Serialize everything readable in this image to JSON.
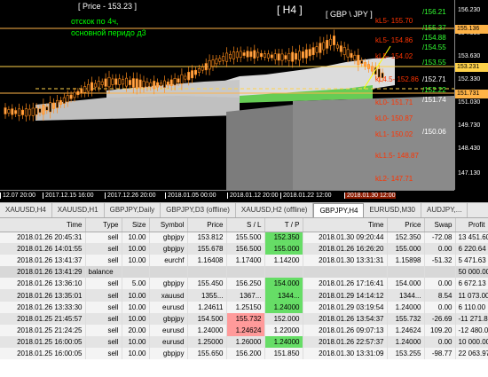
{
  "chart": {
    "title": "[ Price - 153.23 ]",
    "timeframe": "[ H4 ]",
    "pair": "[ GBP \\ JPY ]",
    "note_line1": "отскок по 4ч,",
    "note_line2": "основной перидо д3",
    "y_ticks": [
      "156.230",
      "154.930",
      "153.630",
      "152.330",
      "151.030",
      "149.730",
      "148.430",
      "147.130"
    ],
    "y_markers": [
      {
        "label": "155.136",
        "color": "#ffb347"
      },
      {
        "label": "153.231",
        "color": "#ffd24a"
      },
      {
        "label": "151.731",
        "color": "#ffb347"
      }
    ],
    "x_ticks": [
      "12.07 20:00",
      "2017.12.15 16:00",
      "2017.12.26 20:00",
      "2018.01.05 00:00",
      "2018.01.12 20:00",
      "2018.01.22 12:00",
      "2018.01.30 12:00"
    ],
    "levels_right": [
      {
        "label": "/156.21",
        "color": "#33ff33"
      },
      {
        "label": "/155.37",
        "color": "#33ff33"
      },
      {
        "label": "/154.88",
        "color": "#33ff33"
      },
      {
        "label": "/154.55",
        "color": "#33ff33"
      },
      {
        "label": "/153.55",
        "color": "#33ff33"
      },
      {
        "label": "/152.71",
        "color": "#ffffff"
      },
      {
        "label": "/152.22",
        "color": "#33ff33"
      },
      {
        "label": "/151.74",
        "color": "#ffffff"
      },
      {
        "label": "/150.06",
        "color": "#ffffff"
      }
    ],
    "levels_left": [
      {
        "label": "kL5- 155.70",
        "color": "#ff3300"
      },
      {
        "label": "kL5- 154.86",
        "color": "#ff3300"
      },
      {
        "label": "kL5- 154.02",
        "color": "#ff3300"
      },
      {
        "label": "kL4.5- 152.86",
        "color": "#ff3300"
      },
      {
        "label": "kL0- 151.71",
        "color": "#ff3300"
      },
      {
        "label": "kL0- 150.87",
        "color": "#ff3300"
      },
      {
        "label": "kL1- 150.02",
        "color": "#ff3300"
      },
      {
        "label": "kL1.5- 148.87",
        "color": "#ff3300"
      },
      {
        "label": "kL2- 147.71",
        "color": "#ff3300"
      }
    ]
  },
  "tabs": [
    "XAUUSD,H4",
    "XAUUSD,H1",
    "GBPJPY,Daily",
    "GBPJPY,D3 (offline)",
    "XAUUSD,H2 (offline)",
    "GBPJPY,H4",
    "EURUSD,M30",
    "AUDJPY,..."
  ],
  "active_tab_index": 5,
  "table": {
    "headers": [
      "Time",
      "Type",
      "Size",
      "Symbol",
      "Price",
      "S / L",
      "T / P",
      "Time",
      "Price",
      "Swap",
      "Profit"
    ],
    "rows": [
      [
        "2018.01.26 20:45:31",
        "sell",
        "10.00",
        "gbpjpy",
        "153.812",
        "155.500",
        "152.350",
        "2018.01.30 09:20:44",
        "152.350",
        "-72.08",
        "13 451.60"
      ],
      [
        "2018.01.26 14:01:55",
        "sell",
        "10.00",
        "gbpjpy",
        "155.678",
        "156.500",
        "155.000",
        "2018.01.26 16:26:20",
        "155.000",
        "0.00",
        "6 220.64"
      ],
      [
        "2018.01.26 13:41:37",
        "sell",
        "10.00",
        "eurchf",
        "1.16408",
        "1.17400",
        "1.14200",
        "2018.01.30 13:31:31",
        "1.15898",
        "-51.32",
        "5 471.63"
      ],
      [
        "2018.01.26 13:41:29",
        "balance",
        "",
        "",
        "",
        "",
        "",
        "",
        "",
        "",
        "50 000.00"
      ],
      [
        "2018.01.26 13:36:10",
        "sell",
        "5.00",
        "gbpjpy",
        "155.450",
        "156.250",
        "154.000",
        "2018.01.26 17:16:41",
        "154.000",
        "0.00",
        "6 672.13"
      ],
      [
        "2018.01.26 13:35:01",
        "sell",
        "10.00",
        "xauusd",
        "1355...",
        "1367...",
        "1344...",
        "2018.01.29 14:14:12",
        "1344...",
        "8.54",
        "11 073.00"
      ],
      [
        "2018.01.26 13:33:30",
        "sell",
        "10.00",
        "eurusd",
        "1.24611",
        "1.25150",
        "1.24000",
        "2018.01.29 03:19:54",
        "1.24000",
        "0.00",
        "6 110.00"
      ],
      [
        "2018.01.25 21:45:57",
        "sell",
        "10.00",
        "gbpjpy",
        "154.500",
        "155.732",
        "152.000",
        "2018.01.26 13:54:37",
        "155.732",
        "-26.69",
        "-11 271.83"
      ],
      [
        "2018.01.25 21:24:25",
        "sell",
        "20.00",
        "eurusd",
        "1.24000",
        "1.24624",
        "1.22000",
        "2018.01.26 09:07:13",
        "1.24624",
        "109.20",
        "-12 480.00"
      ],
      [
        "2018.01.25 16:00:05",
        "sell",
        "10.00",
        "eurusd",
        "1.25000",
        "1.26000",
        "1.24000",
        "2018.01.26 22:57:37",
        "1.24000",
        "0.00",
        "10 000.00"
      ],
      [
        "2018.01.25 16:00:05",
        "sell",
        "10.00",
        "gbpjpy",
        "155.650",
        "156.200",
        "151.850",
        "2018.01.30 13:31:09",
        "153.255",
        "-98.77",
        "22 063.97"
      ]
    ],
    "cell_highlights": [
      {
        "row": 0,
        "col": 6,
        "color": "green"
      },
      {
        "row": 1,
        "col": 6,
        "color": "green"
      },
      {
        "row": 4,
        "col": 6,
        "color": "green"
      },
      {
        "row": 5,
        "col": 6,
        "color": "green"
      },
      {
        "row": 6,
        "col": 6,
        "color": "green"
      },
      {
        "row": 7,
        "col": 5,
        "color": "red"
      },
      {
        "row": 8,
        "col": 5,
        "color": "red"
      },
      {
        "row": 9,
        "col": 6,
        "color": "green"
      }
    ]
  }
}
